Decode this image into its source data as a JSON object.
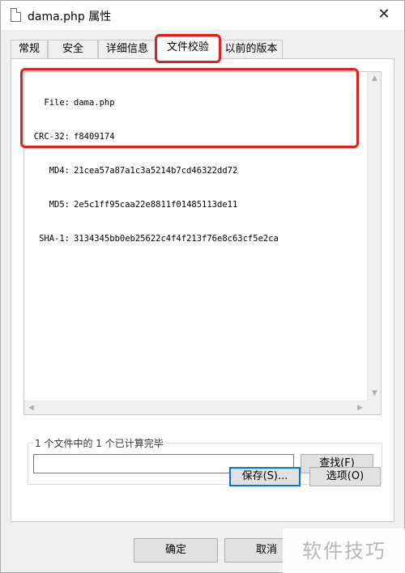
{
  "window": {
    "title": "dama.php 属性",
    "close_glyph": "✕"
  },
  "tabs": [
    {
      "label": "常规"
    },
    {
      "label": "安全"
    },
    {
      "label": "详细信息"
    },
    {
      "label": "文件校验",
      "active": true
    },
    {
      "label": "以前的版本"
    }
  ],
  "hashes": [
    {
      "key": "File:",
      "value": "dama.php"
    },
    {
      "key": "CRC-32:",
      "value": "f8409174"
    },
    {
      "key": "MD4:",
      "value": "21cea57a87a1c3a5214b7cd46322dd72"
    },
    {
      "key": "MD5:",
      "value": "2e5c1ff95caa22e8811f01485113de11"
    },
    {
      "key": "SHA-1:",
      "value": "3134345bb0eb25622c4f4f213f76e8c63cf5e2ca"
    }
  ],
  "progress": {
    "status": "1 个文件中的 1 个已计算完毕",
    "value": ""
  },
  "buttons": {
    "find": "查找(F)",
    "save": "保存(S)...",
    "options": "选项(O)",
    "ok": "确定",
    "cancel": "取消"
  },
  "watermark": "软件技巧",
  "colors": {
    "highlight": "#e02020",
    "focus": "#0078d7"
  },
  "icons": {
    "title": "document-icon",
    "close": "close-icon"
  }
}
